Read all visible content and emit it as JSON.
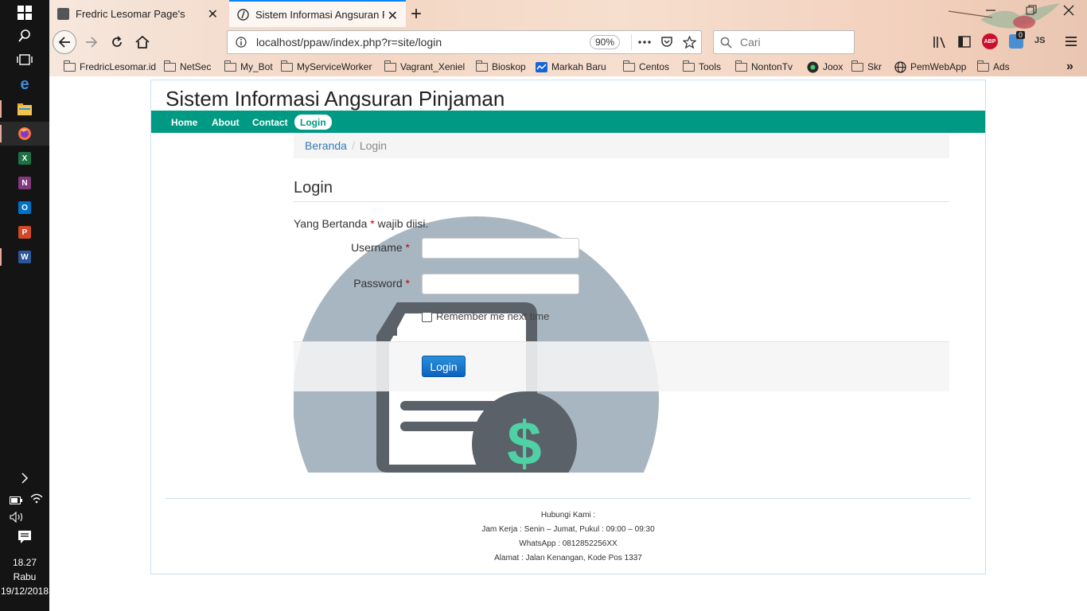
{
  "taskbar": {
    "apps": [
      {
        "icon": "windows-start-icon"
      },
      {
        "icon": "search-icon"
      },
      {
        "icon": "task-view-icon"
      },
      {
        "icon": "edge-icon"
      },
      {
        "icon": "file-explorer-icon"
      },
      {
        "icon": "firefox-icon"
      },
      {
        "icon": "excel-icon"
      },
      {
        "icon": "onenote-icon"
      },
      {
        "icon": "outlook-icon"
      },
      {
        "icon": "powerpoint-icon"
      },
      {
        "icon": "word-icon"
      }
    ],
    "clock": {
      "time": "18.27",
      "day": "Rabu",
      "date": "19/12/2018"
    }
  },
  "browser": {
    "tabs": [
      {
        "title": "Fredric Lesomar Page's",
        "close": "✕"
      },
      {
        "title": "Sistem Informasi Angsuran Pinj",
        "close": "✕"
      }
    ],
    "new_tab": "+",
    "url": "localhost/ppaw/index.php?r=site/login",
    "zoom": "90%",
    "search_placeholder": "Cari",
    "toolbar_right": {
      "abp": "ABP",
      "badge": "0",
      "js": "JS"
    },
    "bookmarks": [
      "FredricLesomar.id",
      "NetSec",
      "My_Bot",
      "MyServiceWorker",
      "Vagrant_Xeniel",
      "Bioskop",
      "Markah Baru",
      "Centos",
      "Tools",
      "NontonTv",
      "Joox",
      "Skr",
      "PemWebApp",
      "Ads"
    ],
    "bookmarks_overflow": "»"
  },
  "site": {
    "title": "Sistem Informasi Angsuran Pinjaman",
    "menu": [
      "Home",
      "About",
      "Contact",
      "Login"
    ],
    "breadcrumb": {
      "home": "Beranda",
      "separator": "/",
      "current": "Login"
    },
    "heading": "Login",
    "note": {
      "prefix": "Yang Bertanda",
      "star": "*",
      "suffix": "wajib diisi."
    },
    "form": {
      "username_label": "Username",
      "password_label": "Password",
      "required_mark": "*",
      "username_value": "",
      "password_value": "",
      "remember_label": "Remember me next time",
      "remember_checked": false,
      "submit_label": "Login"
    },
    "footer": {
      "line1": "Hubungi Kami :",
      "line2": "Jam Kerja : Senin – Jumat, Pukul : 09:00 – 09:30",
      "line3": "WhatsApp : 0812852256XX",
      "line4": "Alamat : Jalan Kenangan, Kode Pos 1337"
    },
    "illustration": {
      "symbol": "$"
    }
  },
  "colors": {
    "menu_bg": "#009a84",
    "link": "#337ab7",
    "required": "#cc0000",
    "button": "#0b63c0",
    "illustration_circle": "#a8b6c1",
    "illustration_dark": "#5b6168",
    "illustration_dollar": "#4fd1a5"
  }
}
